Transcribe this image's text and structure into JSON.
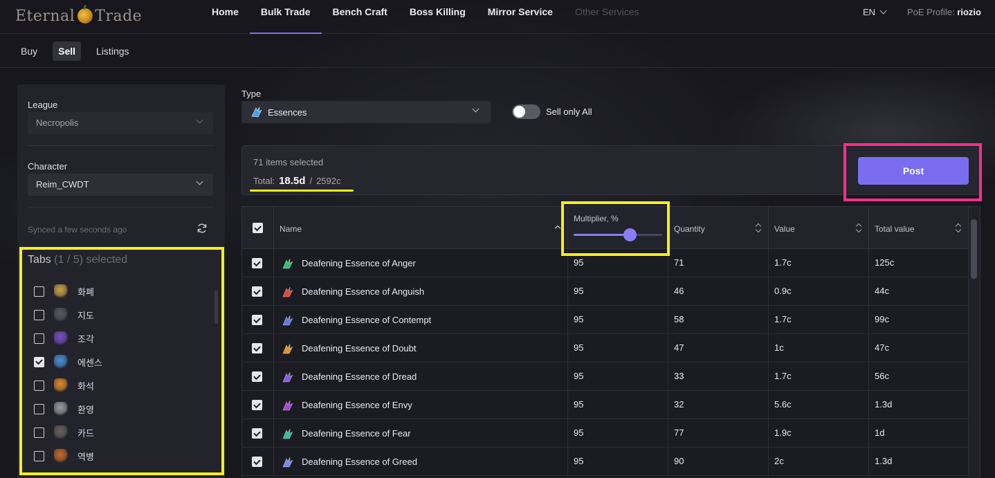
{
  "header": {
    "logo_left": "Eternal",
    "logo_right": "Trade",
    "nav": [
      {
        "label": "Home",
        "active": false
      },
      {
        "label": "Bulk Trade",
        "active": true
      },
      {
        "label": "Bench Craft",
        "active": false
      },
      {
        "label": "Boss Killing",
        "active": false
      },
      {
        "label": "Mirror Service",
        "active": false
      },
      {
        "label": "Other Services",
        "active": false,
        "disabled": true
      }
    ],
    "language": "EN",
    "profile_label": "PoE Profile:",
    "profile_name": "riozio"
  },
  "subtabs": {
    "buy": "Buy",
    "sell": "Sell",
    "listings": "Listings",
    "active": "Sell"
  },
  "sidebar": {
    "league_label": "League",
    "league_value": "Necropolis",
    "character_label": "Character",
    "character_value": "Reim_CWDT",
    "synced_text": "Synced a few seconds ago",
    "tabs_title": "Tabs",
    "tabs_count": "(1 / 5)",
    "tabs_selected": "selected",
    "tabs": [
      {
        "name": "화폐",
        "checked": false,
        "icon": "currency-icon",
        "color": "#c9a24a"
      },
      {
        "name": "지도",
        "checked": false,
        "icon": "map-icon",
        "color": "#5a5a66"
      },
      {
        "name": "조각",
        "checked": false,
        "icon": "fragment-icon",
        "color": "#7a4fc4"
      },
      {
        "name": "에센스",
        "checked": true,
        "icon": "essence-icon",
        "color": "#4a8fd8"
      },
      {
        "name": "화석",
        "checked": false,
        "icon": "fossil-icon",
        "color": "#e08a2a"
      },
      {
        "name": "환영",
        "checked": false,
        "icon": "delirium-icon",
        "color": "#9a9aa2"
      },
      {
        "name": "카드",
        "checked": false,
        "icon": "card-icon",
        "color": "#6a6258"
      },
      {
        "name": "역병",
        "checked": false,
        "icon": "blight-icon",
        "color": "#c46a2a"
      }
    ]
  },
  "main": {
    "type_label": "Type",
    "type_value": "Essences",
    "toggle_label": "Sell only All",
    "toggle_on": false,
    "items_selected": "71 items selected",
    "total_label": "Total:",
    "total_divine": "18.5d",
    "total_sep": "/",
    "total_chaos": "2592c",
    "post_label": "Post"
  },
  "table": {
    "columns": {
      "name": "Name",
      "multiplier": "Multiplier, %",
      "quantity": "Quantity",
      "value": "Value",
      "total_value": "Total value"
    },
    "multiplier_percent": 95,
    "rows": [
      {
        "name": "Deafening Essence of Anger",
        "multiplier": "95",
        "quantity": "71",
        "value": "1.7c",
        "total": "125c",
        "checked": true,
        "color": "#2fbf7a"
      },
      {
        "name": "Deafening Essence of Anguish",
        "multiplier": "95",
        "quantity": "46",
        "value": "0.9c",
        "total": "44c",
        "checked": true,
        "color": "#e0473a"
      },
      {
        "name": "Deafening Essence of Contempt",
        "multiplier": "95",
        "quantity": "58",
        "value": "1.7c",
        "total": "99c",
        "checked": true,
        "color": "#5a7ae8"
      },
      {
        "name": "Deafening Essence of Doubt",
        "multiplier": "95",
        "quantity": "47",
        "value": "1c",
        "total": "47c",
        "checked": true,
        "color": "#e0952a"
      },
      {
        "name": "Deafening Essence of Dread",
        "multiplier": "95",
        "quantity": "33",
        "value": "1.7c",
        "total": "56c",
        "checked": true,
        "color": "#8a5ae0"
      },
      {
        "name": "Deafening Essence of Envy",
        "multiplier": "95",
        "quantity": "32",
        "value": "5.6c",
        "total": "1.3d",
        "checked": true,
        "color": "#b040d8"
      },
      {
        "name": "Deafening Essence of Fear",
        "multiplier": "95",
        "quantity": "77",
        "value": "1.9c",
        "total": "1d",
        "checked": true,
        "color": "#2fbfa0"
      },
      {
        "name": "Deafening Essence of Greed",
        "multiplier": "95",
        "quantity": "90",
        "value": "2c",
        "total": "1.3d",
        "checked": true,
        "color": "#7a8ae8"
      }
    ]
  },
  "colors": {
    "accent": "#7c6cf0",
    "highlight_yellow": "#f5ef1e",
    "highlight_pink": "#ff2d8a"
  }
}
